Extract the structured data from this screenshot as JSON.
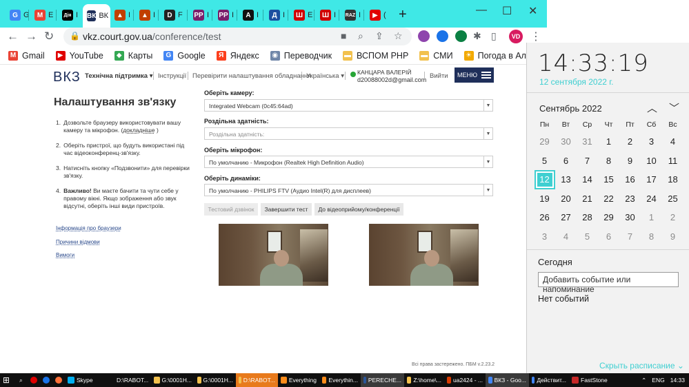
{
  "browser": {
    "tabs": [
      {
        "letter": "G",
        "title": "G",
        "color": "#4285f4"
      },
      {
        "letter": "M",
        "title": "E",
        "color": "#ea4335"
      },
      {
        "letter": "Дія",
        "title": "I",
        "color": "#000000"
      },
      {
        "letter": "ВК",
        "title": "ВК",
        "color": "#1f2f5a",
        "active": true
      },
      {
        "letter": "▲",
        "title": "I",
        "color": "#c04000"
      },
      {
        "letter": "▲",
        "title": "I",
        "color": "#c04000"
      },
      {
        "letter": "D",
        "title": "F",
        "color": "#222222"
      },
      {
        "letter": "PP",
        "title": "I",
        "color": "#7a1f6b"
      },
      {
        "letter": "PP",
        "title": "I",
        "color": "#7a1f6b"
      },
      {
        "letter": "A",
        "title": "I",
        "color": "#111111"
      },
      {
        "letter": "Д",
        "title": "I",
        "color": "#1b4fa0"
      },
      {
        "letter": "Ш",
        "title": "E",
        "color": "#d00000"
      },
      {
        "letter": "Ш",
        "title": "I",
        "color": "#d00000"
      },
      {
        "letter": "RAZ",
        "title": "I",
        "color": "#333333"
      },
      {
        "letter": "▶",
        "title": "(",
        "color": "#e00000"
      }
    ],
    "url_domain": "vkz.court.gov.ua",
    "url_path": "/conference/test",
    "profile_initials": "VD",
    "bookmarks": [
      {
        "label": "Gmail",
        "icon": "M",
        "color": "#ea4335"
      },
      {
        "label": "YouTube",
        "icon": "▶",
        "color": "#e00000"
      },
      {
        "label": "Карты",
        "icon": "◆",
        "color": "#34a853"
      },
      {
        "label": "Google",
        "icon": "G",
        "color": "#4285f4"
      },
      {
        "label": "Яндекс",
        "icon": "Я",
        "color": "#fc3f1d"
      },
      {
        "label": "Переводчик",
        "icon": "◉",
        "color": "#6f86a8"
      },
      {
        "label": "ВСПОМ PHP",
        "icon": "▬",
        "color": "#f2c14e"
      },
      {
        "label": "СМИ",
        "icon": "▬",
        "color": "#f2c14e"
      },
      {
        "label": "Погода в Алчевске",
        "icon": "☀",
        "color": "#f2a900"
      }
    ]
  },
  "site": {
    "logo": "ВКЗ",
    "nav": {
      "support": "Технічна підтримка ▾",
      "instructions": "Інструкції",
      "check_equipment": "Перевірити налаштування обладнання",
      "language": "Українська ▾",
      "user_name": "КАНЦАРА ВАЛЕРІЙ",
      "user_email": "d20088002d@gmail.com",
      "logout": "Вийти",
      "menu": "МЕНЮ"
    },
    "page_title": "Налаштування зв'язку",
    "steps": [
      {
        "num": "1.",
        "text": "Дозвольте браузеру використовувати вашу камеру та мікрофон. (",
        "link": "докладніше",
        "after": " )"
      },
      {
        "num": "2.",
        "text": "Оберіть пристрої, що будуть використані під час відеоконференц-зв'язку."
      },
      {
        "num": "3.",
        "text": "Натисніть кнопку «Подзвонити» для перевірки зв'язку."
      },
      {
        "num": "4.",
        "bold": "Важливо!",
        "text": " Ви маєте бачити та чути себе у правому вікні. Якщо зображення або звук відсутні, оберіть інші види пристроїв."
      }
    ],
    "side_links": [
      "Інформація про браузери",
      "Причини відмови",
      "Вимоги"
    ],
    "fields": {
      "camera_label": "Оберіть камеру:",
      "camera_value": "Integrated Webcam (0c45:64ad)",
      "resolution_label": "Роздільна здатність:",
      "resolution_placeholder": "Роздільна здатність:",
      "mic_label": "Оберіть мікрофон:",
      "mic_value": "По умолчанию - Микрофон (Realtek High Definition Audio)",
      "speaker_label": "Оберіть динаміки:",
      "speaker_value": "По умолчанию - PHILIPS FTV (Аудио Intel(R) для дисплеев)"
    },
    "buttons": {
      "test_call": "Тестовий дзвінок",
      "end_test": "Завершити тест",
      "to_conference": "До відеоприйому/конференції"
    },
    "footer": "Всі права застережено. ПБМ v.2.23.2"
  },
  "calendar": {
    "time": "14:33:19",
    "date_long": "12 сентября 2022 г.",
    "month_title": "Сентябрь 2022",
    "weekdays": [
      "Пн",
      "Вт",
      "Ср",
      "Чт",
      "Пт",
      "Сб",
      "Вс"
    ],
    "days": [
      {
        "d": "29",
        "dim": true
      },
      {
        "d": "30",
        "dim": true
      },
      {
        "d": "31",
        "dim": true
      },
      {
        "d": "1"
      },
      {
        "d": "2"
      },
      {
        "d": "3"
      },
      {
        "d": "4"
      },
      {
        "d": "5"
      },
      {
        "d": "6"
      },
      {
        "d": "7"
      },
      {
        "d": "8"
      },
      {
        "d": "9"
      },
      {
        "d": "10"
      },
      {
        "d": "11"
      },
      {
        "d": "12",
        "today": true
      },
      {
        "d": "13"
      },
      {
        "d": "14"
      },
      {
        "d": "15"
      },
      {
        "d": "16"
      },
      {
        "d": "17"
      },
      {
        "d": "18"
      },
      {
        "d": "19"
      },
      {
        "d": "20"
      },
      {
        "d": "21"
      },
      {
        "d": "22"
      },
      {
        "d": "23"
      },
      {
        "d": "24"
      },
      {
        "d": "25"
      },
      {
        "d": "26"
      },
      {
        "d": "27"
      },
      {
        "d": "28"
      },
      {
        "d": "29"
      },
      {
        "d": "30"
      },
      {
        "d": "1",
        "dim": true
      },
      {
        "d": "2",
        "dim": true
      },
      {
        "d": "3",
        "dim": true
      },
      {
        "d": "4",
        "dim": true
      },
      {
        "d": "5",
        "dim": true
      },
      {
        "d": "6",
        "dim": true
      },
      {
        "d": "7",
        "dim": true
      },
      {
        "d": "8",
        "dim": true
      },
      {
        "d": "9",
        "dim": true
      }
    ],
    "today_label": "Сегодня",
    "add_event": "Добавить событие или напоминание",
    "no_events": "Нет событий",
    "hide_schedule": "Скрыть расписание ⌄"
  },
  "taskbar": {
    "items": [
      {
        "label": "Skype",
        "color": "#00aff0"
      },
      {
        "label": "D:\\RABOT...",
        "color": "#f2c14e"
      },
      {
        "label": "G:\\0001H...",
        "color": "#f2c14e"
      },
      {
        "label": "G:\\0001H...",
        "color": "#f2c14e"
      },
      {
        "label": "D:\\RABOT...",
        "color": "#f2c14e",
        "orange": true
      },
      {
        "label": "Everything",
        "color": "#ff8c1a"
      },
      {
        "label": "Everythin...",
        "color": "#ff8c1a"
      },
      {
        "label": "PERECHE...",
        "color": "#2b579a",
        "hl": true
      },
      {
        "label": "Z:\\home\\...",
        "color": "#f2c14e"
      },
      {
        "label": "ua2424 - ...",
        "color": "#d83b01"
      },
      {
        "label": "ВКЗ - Goo...",
        "color": "#4285f4",
        "hl": true
      },
      {
        "label": "Действит...",
        "color": "#4285f4"
      },
      {
        "label": "FastStone",
        "color": "#c62828"
      }
    ],
    "lang": "ENG",
    "clock": "14:33"
  }
}
